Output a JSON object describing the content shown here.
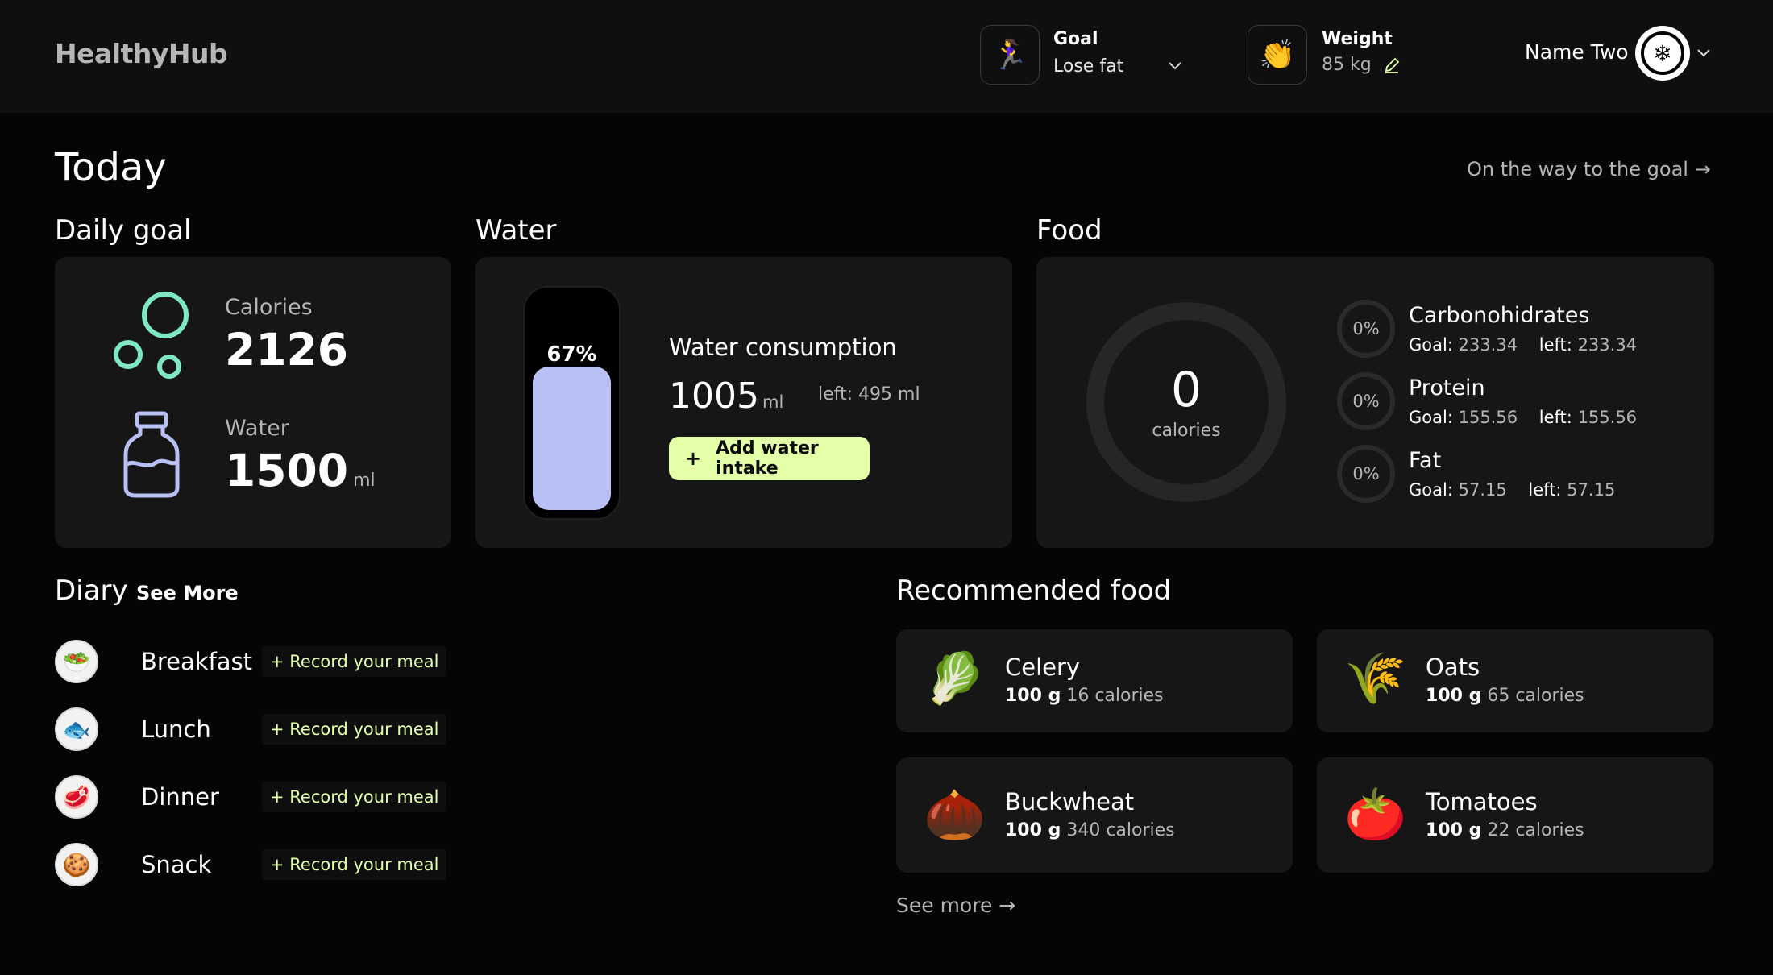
{
  "app": {
    "logo": "HealthyHub"
  },
  "header": {
    "goal": {
      "label": "Goal",
      "value": "Lose fat",
      "icon": "running-woman-emoji"
    },
    "weight": {
      "label": "Weight",
      "value": "85 kg",
      "icon": "clapping-hands-emoji"
    },
    "user": {
      "name": "Name Two"
    }
  },
  "page": {
    "title": "Today",
    "goal_link": "On the way to the goal →"
  },
  "daily_goal": {
    "title": "Daily goal",
    "calories": {
      "label": "Calories",
      "value": "2126"
    },
    "water": {
      "label": "Water",
      "value": "1500",
      "unit": "ml"
    }
  },
  "water": {
    "title": "Water",
    "percent_text": "67%",
    "fill_fraction": 0.67,
    "consumption_label": "Water consumption",
    "amount": "1005",
    "unit": "ml",
    "left_text": "left: 495 ml",
    "add_button": "Add water intake",
    "color_fill": "#b9c1f4"
  },
  "food": {
    "title": "Food",
    "calories_value": "0",
    "calories_label": "calories",
    "macros": [
      {
        "name": "Carbonohidrates",
        "percent": "0%",
        "goal_label": "Goal:",
        "goal": "233.34",
        "left_label": "left:",
        "left": "233.34"
      },
      {
        "name": "Protein",
        "percent": "0%",
        "goal_label": "Goal:",
        "goal": "155.56",
        "left_label": "left:",
        "left": "155.56"
      },
      {
        "name": "Fat",
        "percent": "0%",
        "goal_label": "Goal:",
        "goal": "57.15",
        "left_label": "left:",
        "left": "57.15"
      }
    ]
  },
  "diary": {
    "title": "Diary",
    "see_more": "See More",
    "meals": [
      {
        "name": "Breakfast",
        "action": "+ Record your meal",
        "icon": "salad-emoji"
      },
      {
        "name": "Lunch",
        "action": "+ Record your meal",
        "icon": "fish-dish-emoji"
      },
      {
        "name": "Dinner",
        "action": "+ Record your meal",
        "icon": "meat-dish-emoji"
      },
      {
        "name": "Snack",
        "action": "+ Record your meal",
        "icon": "cookie-emoji"
      }
    ]
  },
  "recommended": {
    "title": "Recommended food",
    "items": [
      {
        "name": "Celery",
        "amount": "100 g",
        "calories": "16 calories",
        "icon": "celery-image"
      },
      {
        "name": "Oats",
        "amount": "100 g",
        "calories": "65 calories",
        "icon": "oats-image"
      },
      {
        "name": "Buckwheat",
        "amount": "100 g",
        "calories": "340 calories",
        "icon": "buckwheat-image"
      },
      {
        "name": "Tomatoes",
        "amount": "100 g",
        "calories": "22 calories",
        "icon": "tomato-image"
      }
    ],
    "see_more": "See more →"
  },
  "colors": {
    "accent": "#e3ffa8",
    "mint": "#7ee8c3",
    "lavender": "#b9c1f4",
    "card": "#161616"
  }
}
